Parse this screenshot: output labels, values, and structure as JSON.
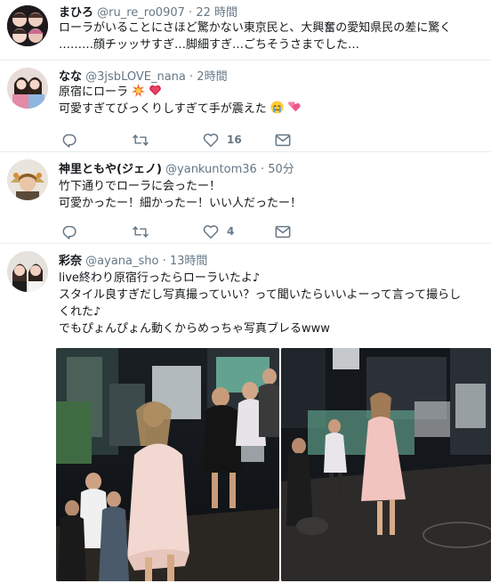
{
  "tweets": [
    {
      "name": "まひろ",
      "handle": "@ru_re_ro0907",
      "time": "22 時間",
      "lines": [
        "ローラがいることにさほど驚かない東京民と、大興奮の愛知県民の差に驚く",
        "………顔チッッサすぎ…脚細すぎ…ごちそうさまでした…"
      ]
    },
    {
      "name": "なな",
      "handle": "@3jsbLOVE_nana",
      "time": "2時間",
      "lines": [
        "原宿にローラ",
        "可愛すぎてびっくりしすぎて手が震えた"
      ],
      "retweets": "",
      "likes": "16"
    },
    {
      "name": "神里ともや(ジェノ)",
      "handle": "@yankuntom36",
      "time": "50分",
      "lines": [
        "竹下通りでローラに会ったー！",
        "可愛かったー！細かったー！いい人だったー！"
      ],
      "retweets": "",
      "likes": "4"
    },
    {
      "name": "彩奈",
      "handle": "@ayana_sho",
      "time": "13時間",
      "lines": [
        "live終わり原宿行ったらローラいたよ♪",
        "スタイル良すぎだし写真撮っていい？って聞いたらいいよーって言って撮らし",
        "くれた♪",
        "でもぴょんぴょん動くからめっちゃ写真ブレるwww"
      ]
    }
  ],
  "dot": "·",
  "icons": [
    "reply-icon",
    "retweet-icon",
    "like-icon",
    "message-icon",
    "explosion-emoji",
    "heart-emoji",
    "crying-emoji",
    "hearts-emoji"
  ]
}
